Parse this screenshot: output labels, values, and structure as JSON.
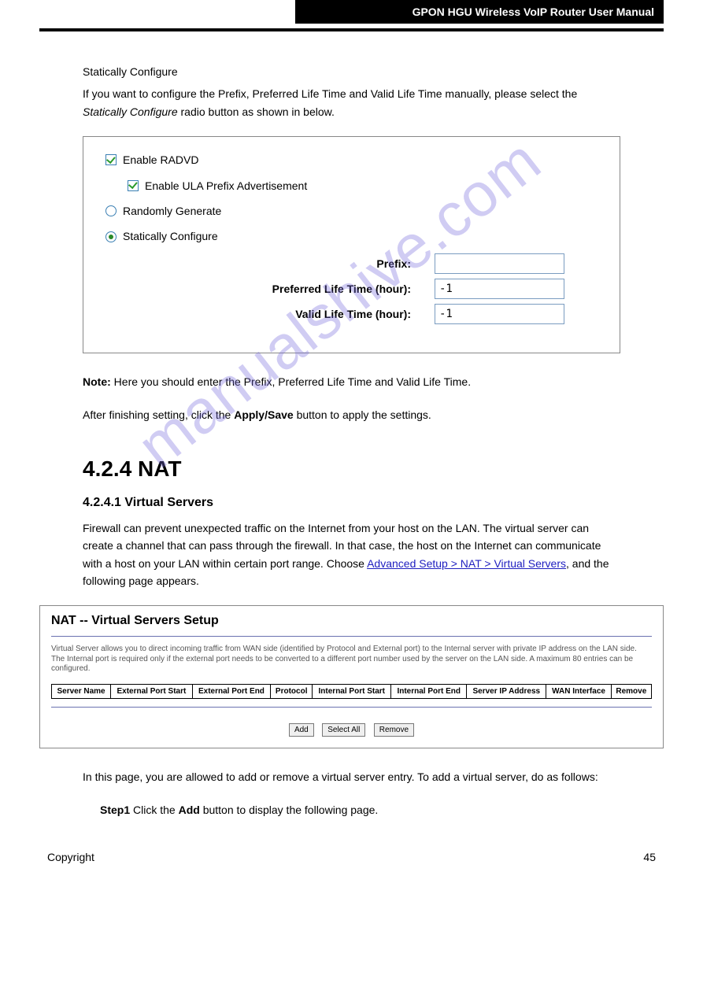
{
  "header": {
    "right": "GPON HGU Wireless VoIP Router User Manual"
  },
  "sec1": {
    "sub_heading": "Statically Configure",
    "paragraph_a": "If you want to configure the Prefix, Preferred Life Time and Valid Life Time manually, please select the ",
    "paragraph_b": "Statically Configure",
    "paragraph_c": " radio button as shown in below."
  },
  "panel1": {
    "enable_radvd": "Enable RADVD",
    "enable_ula": "Enable ULA Prefix Advertisement",
    "randomly": "Randomly Generate",
    "statically": "Statically Configure",
    "prefix_label": "Prefix:",
    "pref_life_label": "Preferred Life Time (hour):",
    "valid_life_label": "Valid Life Time (hour):",
    "pref_life_value": "-1",
    "valid_life_value": "-1"
  },
  "note": {
    "prefix": "Note: ",
    "body": "Here you should enter the Prefix, Preferred Life Time and Valid Life Time."
  },
  "apply1": {
    "a": "After finishing setting, click the ",
    "b": "Apply/Save",
    "c": " button to apply the settings."
  },
  "nat": {
    "heading": "4.2.4 NAT",
    "sub": "4.2.4.1 Virtual Servers",
    "intro_a": "Firewall can prevent unexpected traffic on the Internet from your host on the LAN. The virtual server can create a channel that can pass through the firewall. In that case, the host on the Internet can communicate with a host on your LAN within certain port range. Choose ",
    "intro_b": "Advanced Setup > NAT > Virtual Servers",
    "intro_c": ", and the following page appears."
  },
  "panel2": {
    "title": "NAT -- Virtual Servers Setup",
    "desc": "Virtual Server allows you to direct incoming traffic from WAN side (identified by Protocol and External port) to the Internal server with private IP address on the LAN side. The Internal port is required only if the external port needs to be converted to a different port number used by the server on the LAN side. A maximum 80 entries can be configured.",
    "cols": [
      "Server Name",
      "External Port Start",
      "External Port End",
      "Protocol",
      "Internal Port Start",
      "Internal Port End",
      "Server IP Address",
      "WAN Interface",
      "Remove"
    ],
    "buttons": {
      "add": "Add",
      "select_all": "Select All",
      "remove": "Remove"
    }
  },
  "para2": {
    "a": "In this page, you are allowed to add or remove a virtual server entry. To add a virtual server, do as follows:",
    "step_pre": "Step1 ",
    "step_body_a": "Click the ",
    "step_body_b": "Add",
    "step_body_c": " button to display the following page."
  },
  "footer": {
    "copyright": "Copyright",
    "page": "45"
  },
  "watermark": "manualshive.com"
}
